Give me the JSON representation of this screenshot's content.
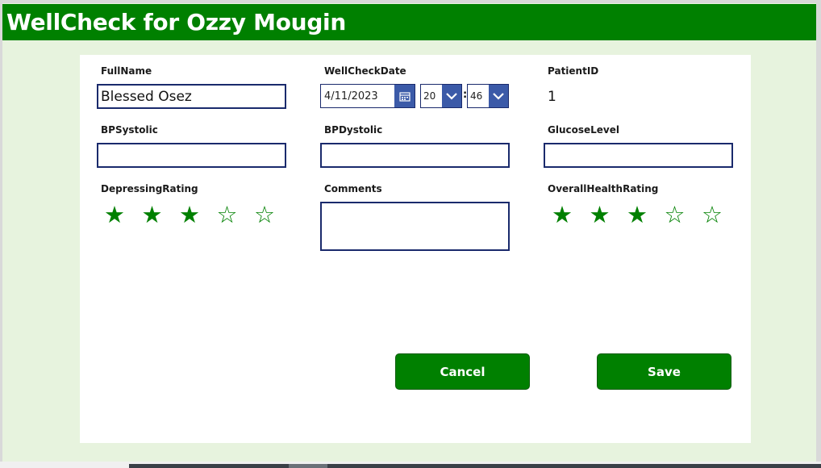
{
  "header": {
    "title": "WellCheck for Ozzy Mougin"
  },
  "form": {
    "fullname": {
      "label": "FullName",
      "value": "Blessed Osez"
    },
    "wellcheckdate": {
      "label": "WellCheckDate",
      "date": "4/11/2023",
      "hour": "20",
      "minute": "46",
      "separator": ":"
    },
    "patientid": {
      "label": "PatientID",
      "value": "1"
    },
    "bpsystolic": {
      "label": "BPSystolic",
      "value": ""
    },
    "bpdystolic": {
      "label": "BPDystolic",
      "value": ""
    },
    "glucoselevel": {
      "label": "GlucoseLevel",
      "value": ""
    },
    "depressingrating": {
      "label": "DepressingRating",
      "rating": 3,
      "max": 5
    },
    "comments": {
      "label": "Comments",
      "value": ""
    },
    "overallhealthrating": {
      "label": "OverallHealthRating",
      "rating": 3,
      "max": 5
    }
  },
  "buttons": {
    "cancel": "Cancel",
    "save": "Save"
  },
  "colors": {
    "header": "#008000",
    "background": "#e7f3de",
    "accent": "#3b5aa8",
    "border": "#1a2a6c"
  },
  "icons": {
    "calendar": "calendar-icon",
    "dropdown": "chevron-down-icon",
    "star_filled": "star-filled-icon",
    "star_empty": "star-outline-icon"
  }
}
